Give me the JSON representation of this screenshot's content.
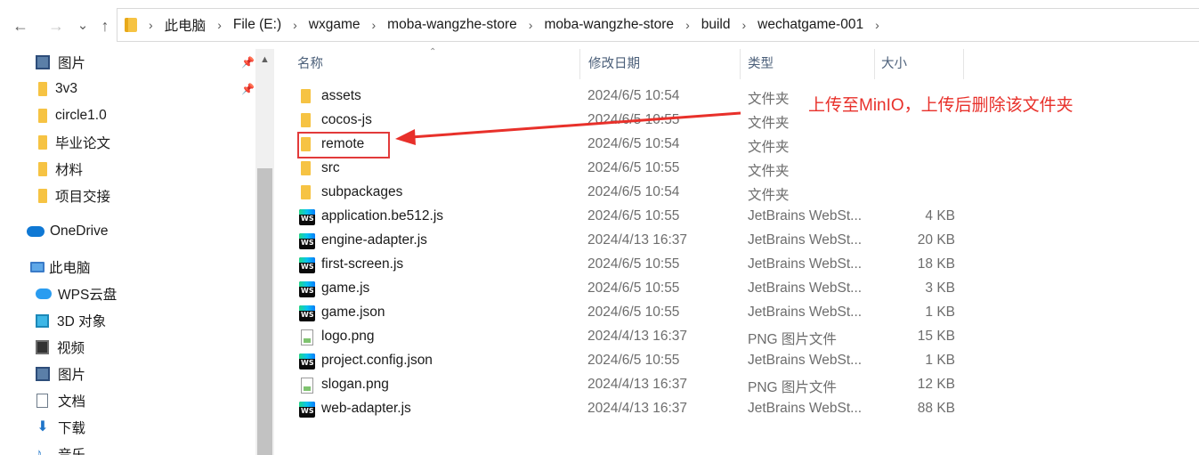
{
  "nav": {
    "back_icon": "←",
    "forward_icon": "→",
    "dropdown_icon": "⌄",
    "up_icon": "↑"
  },
  "breadcrumb": [
    "此电脑",
    "File (E:)",
    "wxgame",
    "moba-wangzhe-store",
    "moba-wangzhe-store",
    "build",
    "wechatgame-001"
  ],
  "sidebar": {
    "items": [
      {
        "label": "图片",
        "icon": "pictures-icon",
        "pinned": true
      },
      {
        "label": "3v3",
        "icon": "folder-icon",
        "pinned": true
      },
      {
        "label": "circle1.0",
        "icon": "folder-icon",
        "pinned": false
      },
      {
        "label": "毕业论文",
        "icon": "folder-icon",
        "pinned": false
      },
      {
        "label": "材料",
        "icon": "folder-icon",
        "pinned": false
      },
      {
        "label": "项目交接",
        "icon": "folder-icon",
        "pinned": false
      },
      {
        "label": "OneDrive",
        "icon": "onedrive-icon",
        "pinned": false
      },
      {
        "label": "此电脑",
        "icon": "computer-icon",
        "pinned": false
      },
      {
        "label": "WPS云盘",
        "icon": "wps-cloud-icon",
        "pinned": false
      },
      {
        "label": "3D 对象",
        "icon": "3d-objects-icon",
        "pinned": false
      },
      {
        "label": "视频",
        "icon": "videos-icon",
        "pinned": false
      },
      {
        "label": "图片",
        "icon": "pictures-icon",
        "pinned": false
      },
      {
        "label": "文档",
        "icon": "documents-icon",
        "pinned": false
      },
      {
        "label": "下载",
        "icon": "downloads-icon",
        "pinned": false
      },
      {
        "label": "音乐",
        "icon": "music-icon",
        "pinned": false
      }
    ]
  },
  "columns": {
    "name": "名称",
    "date": "修改日期",
    "type": "类型",
    "size": "大小"
  },
  "files": [
    {
      "name": "assets",
      "date": "2024/6/5 10:54",
      "type": "文件夹",
      "size": "",
      "icon": "folder"
    },
    {
      "name": "cocos-js",
      "date": "2024/6/5 10:55",
      "type": "文件夹",
      "size": "",
      "icon": "folder"
    },
    {
      "name": "remote",
      "date": "2024/6/5 10:54",
      "type": "文件夹",
      "size": "",
      "icon": "folder"
    },
    {
      "name": "src",
      "date": "2024/6/5 10:55",
      "type": "文件夹",
      "size": "",
      "icon": "folder"
    },
    {
      "name": "subpackages",
      "date": "2024/6/5 10:54",
      "type": "文件夹",
      "size": "",
      "icon": "folder"
    },
    {
      "name": "application.be512.js",
      "date": "2024/6/5 10:55",
      "type": "JetBrains WebSt...",
      "size": "4 KB",
      "icon": "ws"
    },
    {
      "name": "engine-adapter.js",
      "date": "2024/4/13 16:37",
      "type": "JetBrains WebSt...",
      "size": "20 KB",
      "icon": "ws"
    },
    {
      "name": "first-screen.js",
      "date": "2024/6/5 10:55",
      "type": "JetBrains WebSt...",
      "size": "18 KB",
      "icon": "ws"
    },
    {
      "name": "game.js",
      "date": "2024/6/5 10:55",
      "type": "JetBrains WebSt...",
      "size": "3 KB",
      "icon": "ws"
    },
    {
      "name": "game.json",
      "date": "2024/6/5 10:55",
      "type": "JetBrains WebSt...",
      "size": "1 KB",
      "icon": "ws"
    },
    {
      "name": "logo.png",
      "date": "2024/4/13 16:37",
      "type": "PNG 图片文件",
      "size": "15 KB",
      "icon": "png"
    },
    {
      "name": "project.config.json",
      "date": "2024/6/5 10:55",
      "type": "JetBrains WebSt...",
      "size": "1 KB",
      "icon": "ws"
    },
    {
      "name": "slogan.png",
      "date": "2024/4/13 16:37",
      "type": "PNG 图片文件",
      "size": "12 KB",
      "icon": "png"
    },
    {
      "name": "web-adapter.js",
      "date": "2024/4/13 16:37",
      "type": "JetBrains WebSt...",
      "size": "88 KB",
      "icon": "ws"
    }
  ],
  "annotation": {
    "text": "上传至MinIO，上传后删除该文件夹",
    "color": "#e8302a"
  }
}
